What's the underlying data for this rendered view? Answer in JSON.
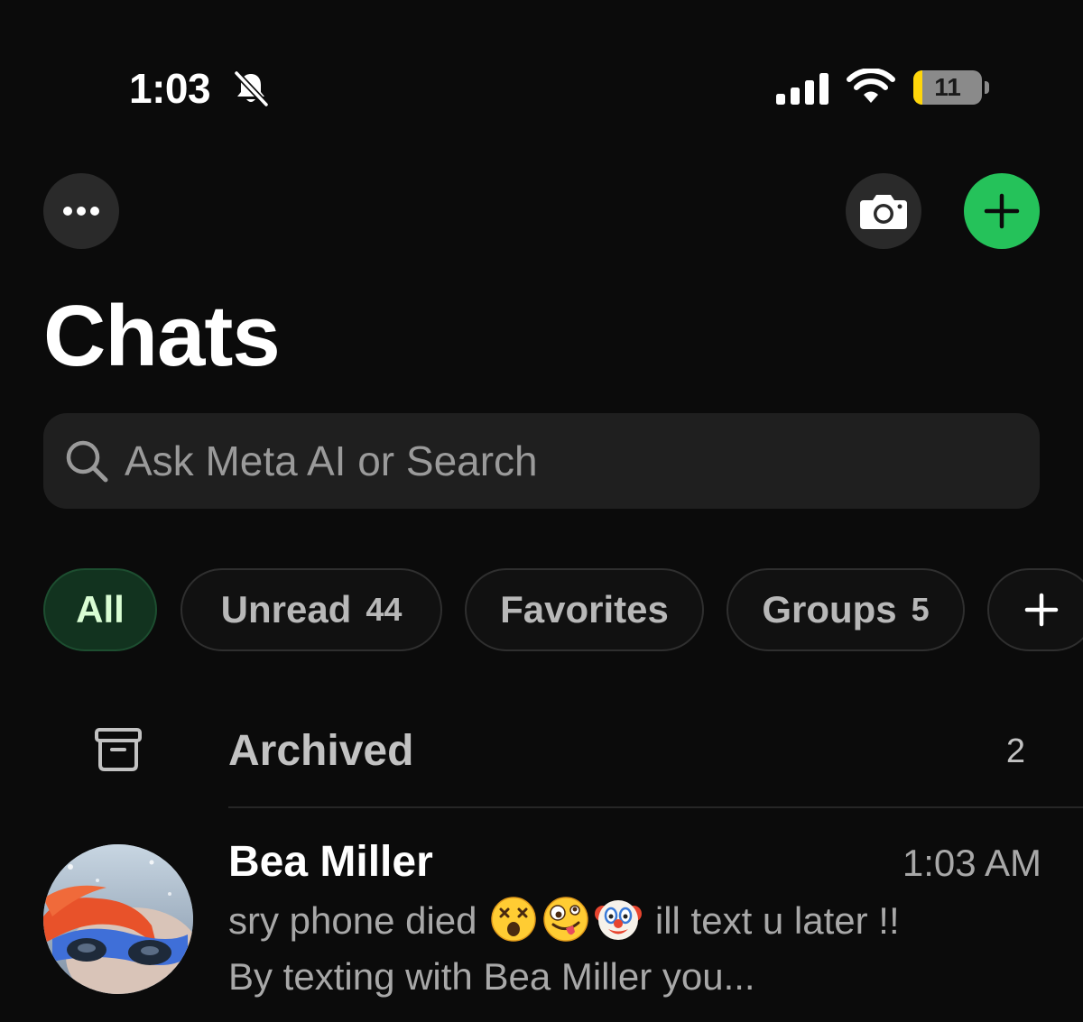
{
  "status_bar": {
    "time": "1:03",
    "battery_level": "11",
    "battery_fraction": 0.11,
    "icons": [
      "bell-muted-icon",
      "cellular-signal-icon",
      "wifi-icon",
      "battery-icon"
    ]
  },
  "toolbar": {
    "more_icon": "ellipsis-icon",
    "camera_icon": "camera-icon",
    "new_chat_icon": "plus-icon",
    "new_chat_color": "#25c25a"
  },
  "page": {
    "title": "Chats"
  },
  "search": {
    "placeholder": "Ask Meta AI or Search",
    "value": ""
  },
  "filters": [
    {
      "label": "All",
      "count": "",
      "selected": true
    },
    {
      "label": "Unread",
      "count": "44",
      "selected": false
    },
    {
      "label": "Favorites",
      "count": "",
      "selected": false
    },
    {
      "label": "Groups",
      "count": "5",
      "selected": false
    }
  ],
  "archived": {
    "label": "Archived",
    "count": "2"
  },
  "chats": [
    {
      "name": "Bea Miller",
      "time": "1:03 AM",
      "preview_part1": "sry phone died",
      "preview_emojis": [
        "dizzy-face-emoji",
        "zany-face-emoji",
        "clown-face-emoji"
      ],
      "preview_part2": "ill text u later !! By texting with Bea Miller you..."
    }
  ]
}
